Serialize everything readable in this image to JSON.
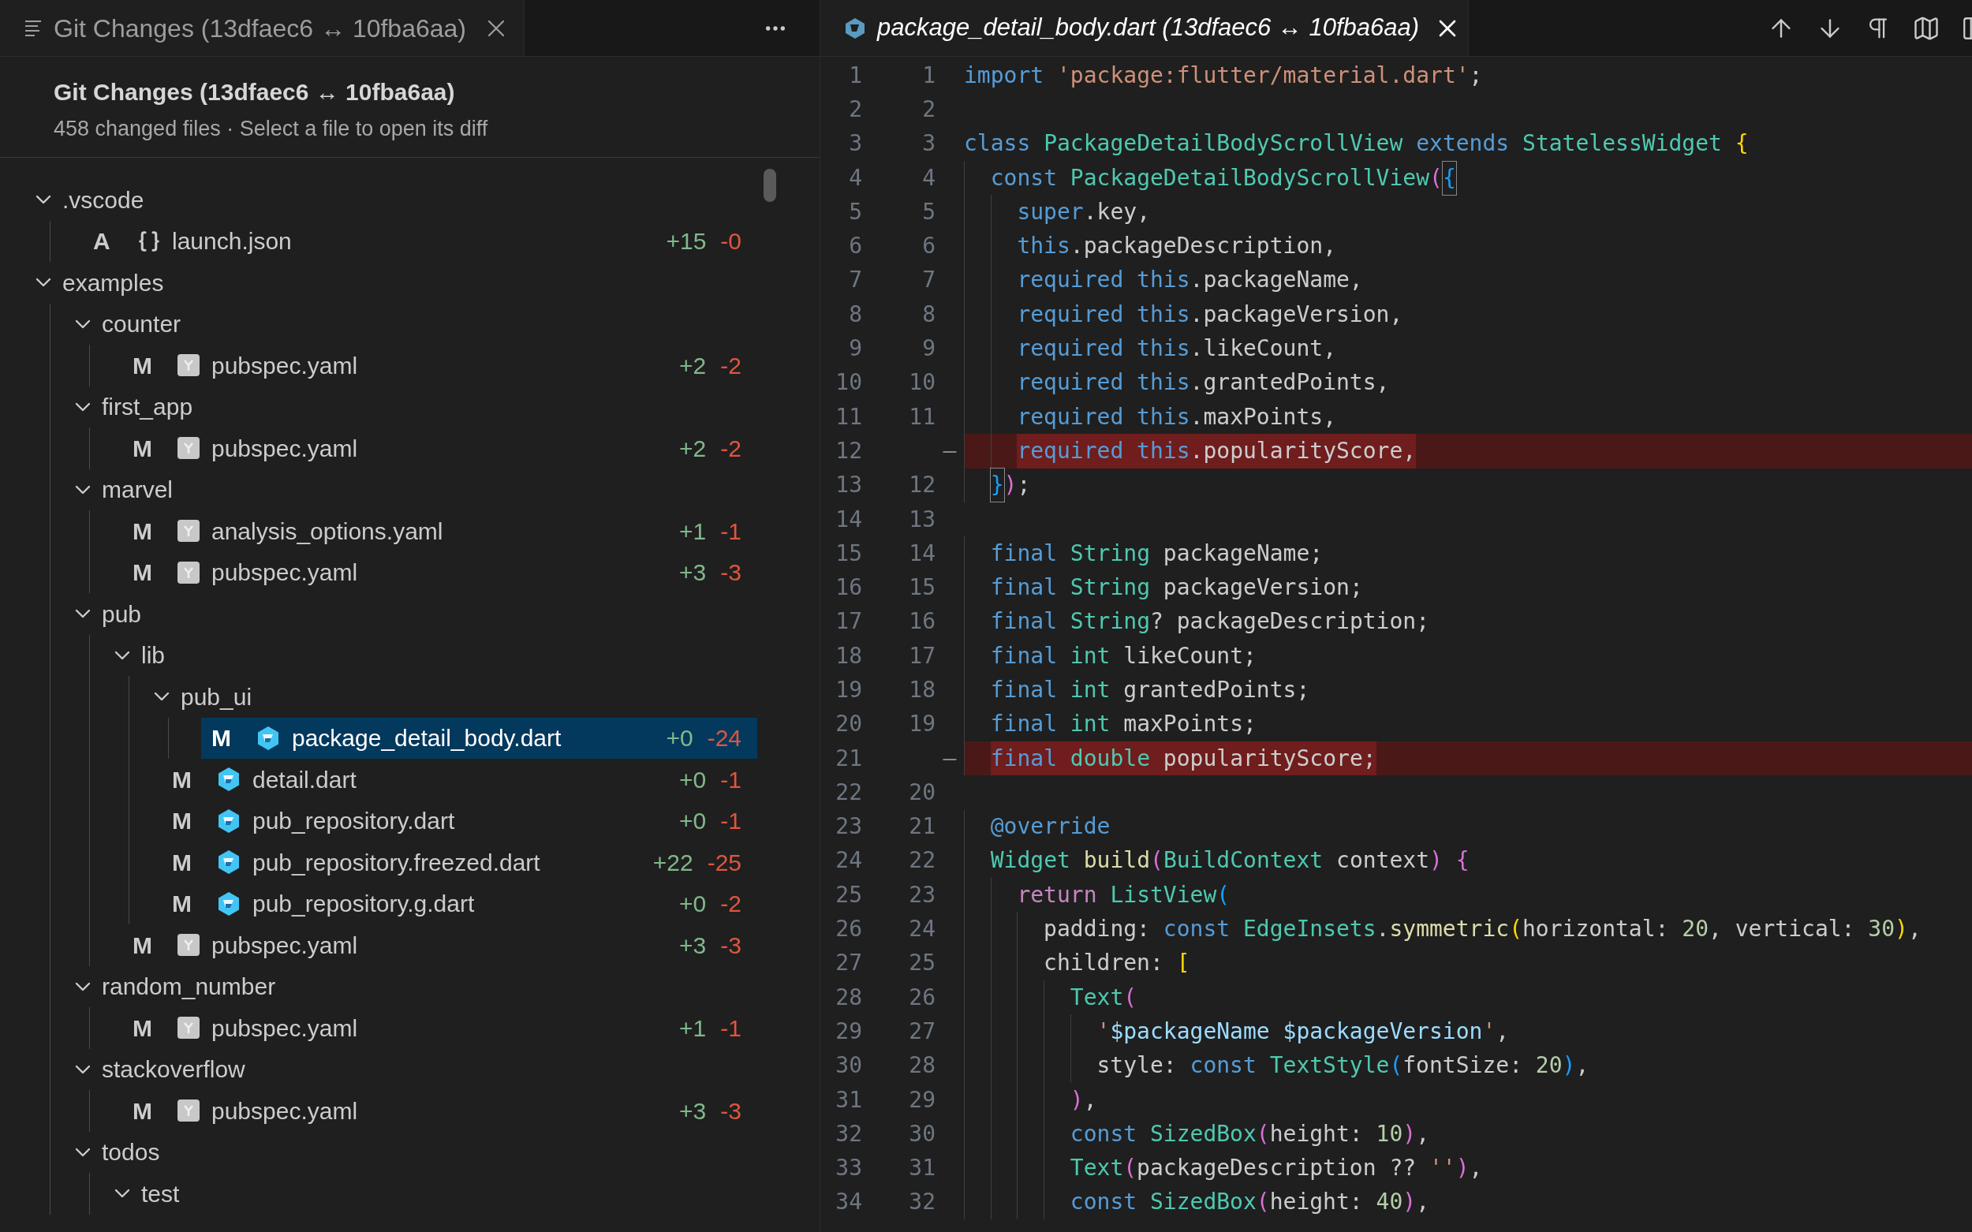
{
  "left_panel": {
    "tab": {
      "title": "Git Changes (13dfaec6 ↔ 10fba6aa)"
    },
    "header": {
      "title": "Git Changes (13dfaec6 ↔ 10fba6aa)",
      "subtitle": "458 changed files · Select a file to open its diff"
    },
    "tree": [
      {
        "kind": "folder",
        "name": ".vscode",
        "expanded": true,
        "children": [
          {
            "kind": "json_file",
            "status": "A",
            "name": "launch.json",
            "added": "+15",
            "removed": "-0",
            "selected": false
          }
        ]
      },
      {
        "kind": "folder",
        "name": "examples",
        "expanded": true,
        "children": [
          {
            "kind": "folder",
            "name": "counter",
            "expanded": true,
            "children": [
              {
                "kind": "yaml_file",
                "status": "M",
                "name": "pubspec.yaml",
                "added": "+2",
                "removed": "-2",
                "selected": false
              }
            ]
          },
          {
            "kind": "folder",
            "name": "first_app",
            "expanded": true,
            "children": [
              {
                "kind": "yaml_file",
                "status": "M",
                "name": "pubspec.yaml",
                "added": "+2",
                "removed": "-2",
                "selected": false
              }
            ]
          },
          {
            "kind": "folder",
            "name": "marvel",
            "expanded": true,
            "children": [
              {
                "kind": "yaml_file",
                "status": "M",
                "name": "analysis_options.yaml",
                "added": "+1",
                "removed": "-1",
                "selected": false
              },
              {
                "kind": "yaml_file",
                "status": "M",
                "name": "pubspec.yaml",
                "added": "+3",
                "removed": "-3",
                "selected": false
              }
            ]
          },
          {
            "kind": "folder",
            "name": "pub",
            "expanded": true,
            "children": [
              {
                "kind": "folder",
                "name": "lib",
                "expanded": true,
                "children": [
                  {
                    "kind": "folder",
                    "name": "pub_ui",
                    "expanded": true,
                    "children": [
                      {
                        "kind": "dart_file",
                        "status": "M",
                        "name": "package_detail_body.dart",
                        "added": "+0",
                        "removed": "-24",
                        "selected": true
                      }
                    ]
                  },
                  {
                    "kind": "dart_file",
                    "status": "M",
                    "name": "detail.dart",
                    "added": "+0",
                    "removed": "-1",
                    "selected": false
                  },
                  {
                    "kind": "dart_file",
                    "status": "M",
                    "name": "pub_repository.dart",
                    "added": "+0",
                    "removed": "-1",
                    "selected": false
                  },
                  {
                    "kind": "dart_file",
                    "status": "M",
                    "name": "pub_repository.freezed.dart",
                    "added": "+22",
                    "removed": "-25",
                    "selected": false
                  },
                  {
                    "kind": "dart_file",
                    "status": "M",
                    "name": "pub_repository.g.dart",
                    "added": "+0",
                    "removed": "-2",
                    "selected": false
                  }
                ]
              },
              {
                "kind": "yaml_file",
                "status": "M",
                "name": "pubspec.yaml",
                "added": "+3",
                "removed": "-3",
                "selected": false
              }
            ]
          },
          {
            "kind": "folder",
            "name": "random_number",
            "expanded": true,
            "children": [
              {
                "kind": "yaml_file",
                "status": "M",
                "name": "pubspec.yaml",
                "added": "+1",
                "removed": "-1",
                "selected": false
              }
            ]
          },
          {
            "kind": "folder",
            "name": "stackoverflow",
            "expanded": true,
            "children": [
              {
                "kind": "yaml_file",
                "status": "M",
                "name": "pubspec.yaml",
                "added": "+3",
                "removed": "-3",
                "selected": false
              }
            ]
          },
          {
            "kind": "folder",
            "name": "todos",
            "expanded": true,
            "children": [
              {
                "kind": "folder",
                "name": "test",
                "expanded": true
              }
            ]
          }
        ]
      }
    ]
  },
  "editor": {
    "tab": {
      "title": "package_detail_body.dart (13dfaec6 ↔ 10fba6aa)"
    },
    "lines": [
      {
        "orig": "1",
        "mod": "1",
        "deleted": false,
        "code": [
          {
            "kind": "kw",
            "text": "import"
          },
          {
            "kind": "str",
            "text": " 'package:flutter/material.dart'"
          },
          {
            "kind": "plain",
            "text": ";"
          }
        ]
      },
      {
        "orig": "2",
        "mod": "2",
        "deleted": false
      },
      {
        "orig": "3",
        "mod": "3",
        "deleted": false,
        "code": [
          {
            "kind": "kw",
            "text": "class"
          },
          {
            "kind": "type",
            "text": " PackageDetailBodyScrollView"
          },
          {
            "kind": "kw",
            "text": " extends"
          },
          {
            "kind": "type",
            "text": " StatelessWidget"
          },
          {
            "kind": "b1",
            "text": " {"
          }
        ]
      },
      {
        "orig": "4",
        "mod": "4",
        "deleted": false,
        "code": [
          {
            "kind": "kw",
            "text": "  const"
          },
          {
            "kind": "type",
            "text": " PackageDetailBodyScrollView"
          },
          {
            "kind": "b2",
            "text": "("
          },
          {
            "kind": "match",
            "text": "{"
          }
        ]
      },
      {
        "orig": "5",
        "mod": "5",
        "deleted": false,
        "code": [
          {
            "kind": "kw",
            "text": "    super"
          },
          {
            "kind": "plain",
            "text": ".key,"
          }
        ]
      },
      {
        "orig": "6",
        "mod": "6",
        "deleted": false,
        "code": [
          {
            "kind": "kw",
            "text": "    this"
          },
          {
            "kind": "plain",
            "text": ".packageDescription,"
          }
        ]
      },
      {
        "orig": "7",
        "mod": "7",
        "deleted": false,
        "code": [
          {
            "kind": "kw",
            "text": "    required this"
          },
          {
            "kind": "plain",
            "text": ".packageName,"
          }
        ]
      },
      {
        "orig": "8",
        "mod": "8",
        "deleted": false,
        "code": [
          {
            "kind": "kw",
            "text": "    required this"
          },
          {
            "kind": "plain",
            "text": ".packageVersion,"
          }
        ]
      },
      {
        "orig": "9",
        "mod": "9",
        "deleted": false,
        "code": [
          {
            "kind": "kw",
            "text": "    required this"
          },
          {
            "kind": "plain",
            "text": ".likeCount,"
          }
        ]
      },
      {
        "orig": "10",
        "mod": "10",
        "deleted": false,
        "code": [
          {
            "kind": "kw",
            "text": "    required this"
          },
          {
            "kind": "plain",
            "text": ".grantedPoints,"
          }
        ]
      },
      {
        "orig": "11",
        "mod": "11",
        "deleted": false,
        "code": [
          {
            "kind": "kw",
            "text": "    required this"
          },
          {
            "kind": "plain",
            "text": ".maxPoints,"
          }
        ]
      },
      {
        "orig": "12",
        "mark": "—",
        "deleted": true,
        "code": [
          {
            "kind": "kw",
            "text": "    required this"
          },
          {
            "kind": "plain",
            "text": ".popularityScore,"
          }
        ]
      },
      {
        "orig": "13",
        "mod": "12",
        "deleted": false,
        "code": [
          {
            "kind": "match",
            "text": "  }"
          },
          {
            "kind": "b2",
            "text": ")"
          },
          {
            "kind": "plain",
            "text": ";"
          }
        ]
      },
      {
        "orig": "14",
        "mod": "13",
        "deleted": false
      },
      {
        "orig": "15",
        "mod": "14",
        "deleted": false,
        "code": [
          {
            "kind": "kw",
            "text": "  final"
          },
          {
            "kind": "type",
            "text": " String"
          },
          {
            "kind": "plain",
            "text": " packageName;"
          }
        ]
      },
      {
        "orig": "16",
        "mod": "15",
        "deleted": false,
        "code": [
          {
            "kind": "kw",
            "text": "  final"
          },
          {
            "kind": "type",
            "text": " String"
          },
          {
            "kind": "plain",
            "text": " packageVersion;"
          }
        ]
      },
      {
        "orig": "17",
        "mod": "16",
        "deleted": false,
        "code": [
          {
            "kind": "kw",
            "text": "  final"
          },
          {
            "kind": "type",
            "text": " String"
          },
          {
            "kind": "plain",
            "text": "? packageDescription;"
          }
        ]
      },
      {
        "orig": "18",
        "mod": "17",
        "deleted": false,
        "code": [
          {
            "kind": "kw",
            "text": "  final"
          },
          {
            "kind": "type",
            "text": " int"
          },
          {
            "kind": "plain",
            "text": " likeCount;"
          }
        ]
      },
      {
        "orig": "19",
        "mod": "18",
        "deleted": false,
        "code": [
          {
            "kind": "kw",
            "text": "  final"
          },
          {
            "kind": "type",
            "text": " int"
          },
          {
            "kind": "plain",
            "text": " grantedPoints;"
          }
        ]
      },
      {
        "orig": "20",
        "mod": "19",
        "deleted": false,
        "code": [
          {
            "kind": "kw",
            "text": "  final"
          },
          {
            "kind": "type",
            "text": " int"
          },
          {
            "kind": "plain",
            "text": " maxPoints;"
          }
        ]
      },
      {
        "orig": "21",
        "mark": "—",
        "deleted": true,
        "code": [
          {
            "kind": "kw",
            "text": "  final"
          },
          {
            "kind": "type",
            "text": " double"
          },
          {
            "kind": "plain",
            "text": " popularityScore;"
          }
        ]
      },
      {
        "orig": "22",
        "mod": "20",
        "deleted": false
      },
      {
        "orig": "23",
        "mod": "21",
        "deleted": false,
        "code": [
          {
            "kind": "kw",
            "text": "  @override"
          }
        ]
      },
      {
        "orig": "24",
        "mod": "22",
        "deleted": false,
        "code": [
          {
            "kind": "type",
            "text": "  Widget"
          },
          {
            "kind": "fn",
            "text": " build"
          },
          {
            "kind": "b2",
            "text": "("
          },
          {
            "kind": "type",
            "text": "BuildContext"
          },
          {
            "kind": "plain",
            "text": " context"
          },
          {
            "kind": "b2",
            "text": ")"
          },
          {
            "kind": "b2",
            "text": " {"
          }
        ]
      },
      {
        "orig": "25",
        "mod": "23",
        "deleted": false,
        "code": [
          {
            "kind": "ctrl",
            "text": "    return"
          },
          {
            "kind": "type",
            "text": " ListView"
          },
          {
            "kind": "b3",
            "text": "("
          }
        ]
      },
      {
        "orig": "26",
        "mod": "24",
        "deleted": false,
        "code": [
          {
            "kind": "plain",
            "text": "      padding:"
          },
          {
            "kind": "kw",
            "text": " const"
          },
          {
            "kind": "type",
            "text": " EdgeInsets"
          },
          {
            "kind": "plain",
            "text": "."
          },
          {
            "kind": "fn",
            "text": "symmetric"
          },
          {
            "kind": "b1",
            "text": "("
          },
          {
            "kind": "plain",
            "text": "horizontal:"
          },
          {
            "kind": "num",
            "text": " 20"
          },
          {
            "kind": "plain",
            "text": ", vertical:"
          },
          {
            "kind": "num",
            "text": " 30"
          },
          {
            "kind": "b1",
            "text": ")"
          },
          {
            "kind": "plain",
            "text": ","
          }
        ]
      },
      {
        "orig": "27",
        "mod": "25",
        "deleted": false,
        "code": [
          {
            "kind": "plain",
            "text": "      children:"
          },
          {
            "kind": "b1",
            "text": " ["
          }
        ]
      },
      {
        "orig": "28",
        "mod": "26",
        "deleted": false,
        "code": [
          {
            "kind": "type",
            "text": "        Text"
          },
          {
            "kind": "b2",
            "text": "("
          }
        ]
      },
      {
        "orig": "29",
        "mod": "27",
        "deleted": false,
        "code": [
          {
            "kind": "str",
            "text": "          '"
          },
          {
            "kind": "var",
            "text": "$packageName"
          },
          {
            "kind": "var",
            "text": " $packageVersion"
          },
          {
            "kind": "str",
            "text": "'"
          },
          {
            "kind": "plain",
            "text": ","
          }
        ]
      },
      {
        "orig": "30",
        "mod": "28",
        "deleted": false,
        "code": [
          {
            "kind": "plain",
            "text": "          style:"
          },
          {
            "kind": "kw",
            "text": " const"
          },
          {
            "kind": "type",
            "text": " TextStyle"
          },
          {
            "kind": "b3",
            "text": "("
          },
          {
            "kind": "plain",
            "text": "fontSize:"
          },
          {
            "kind": "num",
            "text": " 20"
          },
          {
            "kind": "b3",
            "text": ")"
          },
          {
            "kind": "plain",
            "text": ","
          }
        ]
      },
      {
        "orig": "31",
        "mod": "29",
        "deleted": false,
        "code": [
          {
            "kind": "b2",
            "text": "        )"
          },
          {
            "kind": "plain",
            "text": ","
          }
        ]
      },
      {
        "orig": "32",
        "mod": "30",
        "deleted": false,
        "code": [
          {
            "kind": "kw",
            "text": "        const"
          },
          {
            "kind": "type",
            "text": " SizedBox"
          },
          {
            "kind": "b2",
            "text": "("
          },
          {
            "kind": "plain",
            "text": "height:"
          },
          {
            "kind": "num",
            "text": " 10"
          },
          {
            "kind": "b2",
            "text": ")"
          },
          {
            "kind": "plain",
            "text": ","
          }
        ]
      },
      {
        "orig": "33",
        "mod": "31",
        "deleted": false,
        "code": [
          {
            "kind": "type",
            "text": "        Text"
          },
          {
            "kind": "b2",
            "text": "("
          },
          {
            "kind": "plain",
            "text": "packageDescription ??"
          },
          {
            "kind": "str",
            "text": " ''"
          },
          {
            "kind": "b2",
            "text": ")"
          },
          {
            "kind": "plain",
            "text": ","
          }
        ]
      },
      {
        "orig": "34",
        "mod": "32",
        "deleted": false,
        "code": [
          {
            "kind": "kw",
            "text": "        const"
          },
          {
            "kind": "type",
            "text": " SizedBox"
          },
          {
            "kind": "b2",
            "text": "("
          },
          {
            "kind": "plain",
            "text": "height:"
          },
          {
            "kind": "num",
            "text": " 40"
          },
          {
            "kind": "b2",
            "text": ")"
          },
          {
            "kind": "plain",
            "text": ","
          }
        ]
      }
    ]
  }
}
